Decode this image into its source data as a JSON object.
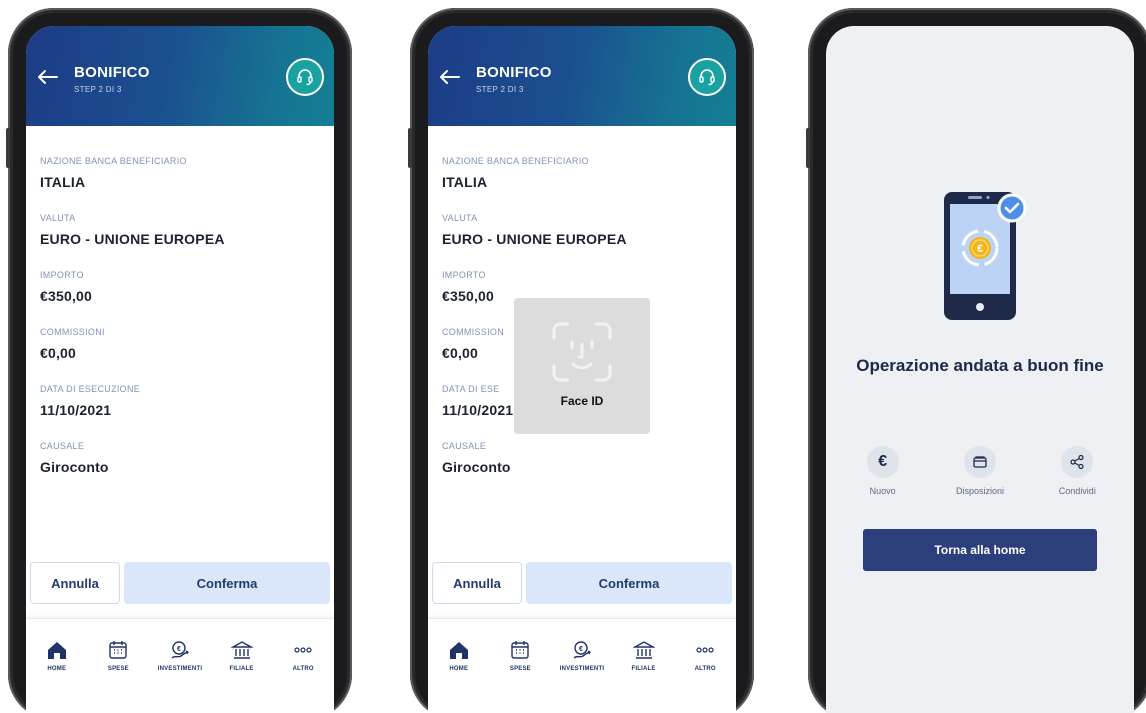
{
  "header": {
    "title": "BONIFICO",
    "step": "STEP 2 DI 3"
  },
  "fields": [
    {
      "label": "NAZIONE BANCA BENEFICIARIO",
      "value": "ITALIA"
    },
    {
      "label": "VALUTA",
      "value": "EURO - UNIONE EUROPEA"
    },
    {
      "label": "IMPORTO",
      "value": "€350,00"
    },
    {
      "label": "COMMISSIONI",
      "value": "€0,00"
    },
    {
      "label": "DATA DI ESECUZIONE",
      "value": "11/10/2021"
    },
    {
      "label": "CAUSALE",
      "value": "Giroconto"
    }
  ],
  "faceid_partial_labels": {
    "commissioni": "COMMISSION",
    "data": "DATA DI ESE"
  },
  "actions": {
    "cancel": "Annulla",
    "confirm": "Conferma"
  },
  "tabbar": [
    {
      "label": "HOME",
      "icon": "home-icon"
    },
    {
      "label": "SPESE",
      "icon": "calendar-icon"
    },
    {
      "label": "INVESTIMENTI",
      "icon": "investment-icon"
    },
    {
      "label": "FILIALE",
      "icon": "bank-icon"
    },
    {
      "label": "ALTRO",
      "icon": "more-icon"
    }
  ],
  "faceid": {
    "label": "Face ID"
  },
  "success": {
    "title": "Operazione andata a buon fine",
    "quick_actions": [
      {
        "label": "Nuovo",
        "glyph": "€"
      },
      {
        "label": "Disposizioni",
        "icon": "wallet-icon"
      },
      {
        "label": "Condividi",
        "icon": "share-icon"
      }
    ],
    "home_button": "Torna alla home"
  },
  "colors": {
    "header_start": "#1d3c86",
    "header_end": "#137f93",
    "support": "#1aa2a2",
    "label": "#7f93b5",
    "primary": "#2c3f7c",
    "confirm_bg": "#dae7fa",
    "check": "#4a8fe8",
    "coin": "#f3b418"
  }
}
